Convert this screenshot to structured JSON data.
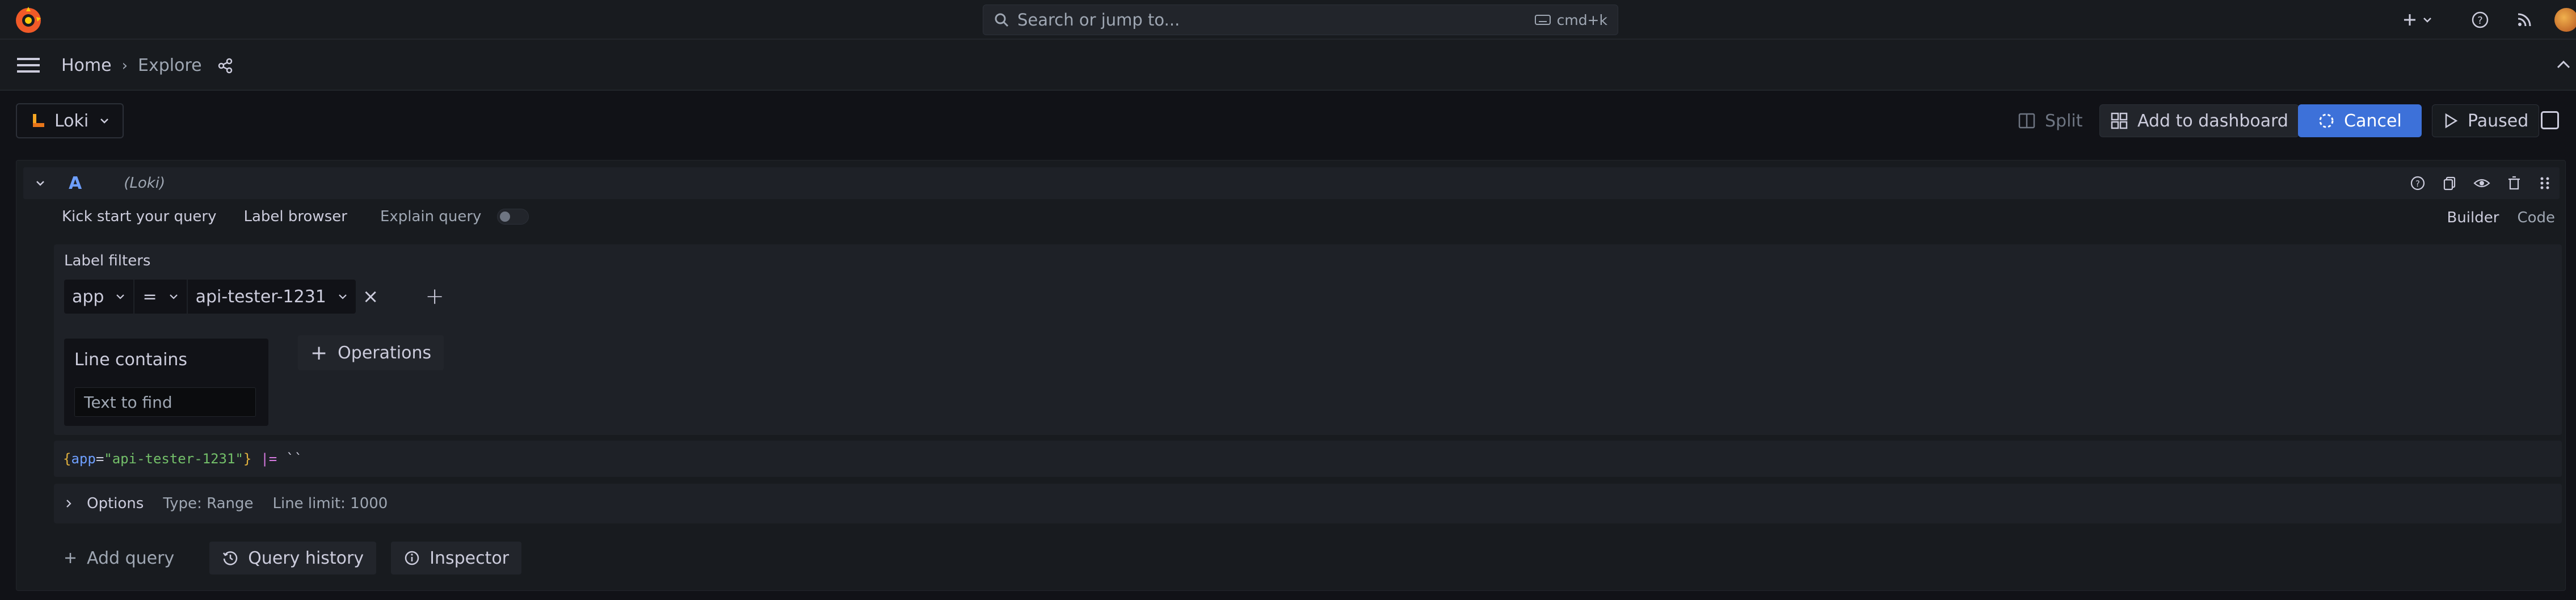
{
  "topbar": {
    "search_placeholder": "Search or jump to...",
    "shortcut": "cmd+k"
  },
  "nav": {
    "breadcrumb_home": "Home",
    "breadcrumb_current": "Explore"
  },
  "toolbar": {
    "datasource": "Loki",
    "split_label": "Split",
    "add_to_dashboard_label": "Add to dashboard",
    "cancel_label": "Cancel",
    "paused_label": "Paused"
  },
  "query": {
    "ref_id": "A",
    "datasource_name": "(Loki)",
    "kick_start_label": "Kick start your query",
    "label_browser_label": "Label browser",
    "explain_label": "Explain query",
    "explain_enabled": false,
    "mode_builder": "Builder",
    "mode_code": "Code",
    "label_filters_title": "Label filters",
    "filter": {
      "label": "app",
      "operator": "=",
      "value": "api-tester-1231"
    },
    "operation": {
      "title": "Line contains",
      "placeholder": "Text to find"
    },
    "operations_button": "Operations",
    "preview": {
      "open_brace": "{",
      "key": "app",
      "eq": "=",
      "value": "\"api-tester-1231\"",
      "close_brace": "}",
      "pipe": "|=",
      "literal": "``"
    },
    "options": {
      "title": "Options",
      "type": "Type: Range",
      "line_limit": "Line limit: 1000"
    }
  },
  "actions": {
    "add_query": "Add query",
    "query_history": "Query history",
    "inspector": "Inspector"
  },
  "colors": {
    "background": "#111217",
    "panel": "#181b1f",
    "primary": "#3d71d9",
    "text": "#ccccdc",
    "secondary_text": "#9fa7b3"
  }
}
